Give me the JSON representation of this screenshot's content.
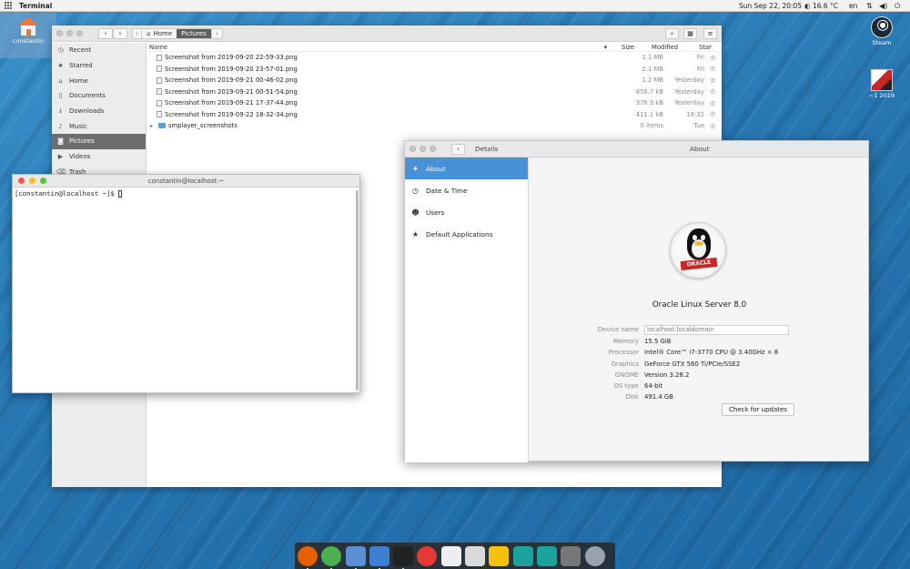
{
  "topbar": {
    "app_name": "Terminal",
    "clock": "Sun Sep 22, 20:05",
    "weather": "16.6 °C",
    "lang": "en"
  },
  "desktop": {
    "home_label": "constantin",
    "steam_label": "Steam",
    "game_label": "~1 2019"
  },
  "files": {
    "crumbs": [
      "Home",
      "Pictures"
    ],
    "sidebar": [
      {
        "label": "Recent",
        "icon": "clock-icon"
      },
      {
        "label": "Starred",
        "icon": "star-icon"
      },
      {
        "label": "Home",
        "icon": "home-icon"
      },
      {
        "label": "Documents",
        "icon": "document-icon"
      },
      {
        "label": "Downloads",
        "icon": "download-icon"
      },
      {
        "label": "Music",
        "icon": "music-icon"
      },
      {
        "label": "Pictures",
        "icon": "camera-icon"
      },
      {
        "label": "Videos",
        "icon": "video-icon"
      },
      {
        "label": "Trash",
        "icon": "trash-icon"
      }
    ],
    "columns": {
      "name": "Name",
      "size": "Size",
      "modified": "Modified",
      "star": "Star"
    },
    "rows": [
      {
        "name": "Screenshot from 2019-09-20 22-59-33.png",
        "size": "1.1 MB",
        "modified": "Fri"
      },
      {
        "name": "Screenshot from 2019-09-20 23-57-01.png",
        "size": "2.1 MB",
        "modified": "Fri"
      },
      {
        "name": "Screenshot from 2019-09-21 00-46-02.png",
        "size": "1.2 MB",
        "modified": "Yesterday"
      },
      {
        "name": "Screenshot from 2019-09-21 00-51-54.png",
        "size": "856.7 kB",
        "modified": "Yesterday"
      },
      {
        "name": "Screenshot from 2019-09-21 17-37-44.png",
        "size": "376.9 kB",
        "modified": "Yesterday"
      },
      {
        "name": "Screenshot from 2019-09-22 18-32-34.png",
        "size": "411.1 kB",
        "modified": "18:32"
      },
      {
        "name": "smplayer_screenshots",
        "size": "0 items",
        "modified": "Tue"
      }
    ]
  },
  "terminal": {
    "title": "constantin@localhost:~",
    "prompt": "[constantin@localhost ~]$ "
  },
  "details": {
    "title": "Details",
    "panel_title": "About",
    "sidebar": [
      {
        "label": "About",
        "icon": "plus-star-icon"
      },
      {
        "label": "Date & Time",
        "icon": "clock-icon"
      },
      {
        "label": "Users",
        "icon": "users-icon"
      },
      {
        "label": "Default Applications",
        "icon": "star-icon"
      }
    ],
    "logo_text": "ORACLE",
    "os_name": "Oracle Linux Server 8.0",
    "device_name_label": "Device name",
    "device_name_value": "localhost.localdomain",
    "specs": [
      {
        "key": "Memory",
        "value": "15.5 GiB"
      },
      {
        "key": "Processor",
        "value": "Intel® Core™ i7-3770 CPU @ 3.40GHz × 8"
      },
      {
        "key": "Graphics",
        "value": "GeForce GTX 560 Ti/PCIe/SSE2"
      },
      {
        "key": "GNOME",
        "value": "Version 3.28.2"
      },
      {
        "key": "OS type",
        "value": "64-bit"
      },
      {
        "key": "Disk",
        "value": "491.4 GB"
      }
    ],
    "update_button": "Check for updates"
  },
  "dock": [
    {
      "name": "firefox-icon",
      "color": "#e66000"
    },
    {
      "name": "chrome-icon",
      "color": "#4caf50"
    },
    {
      "name": "text-editor-icon",
      "color": "#5b8fd6"
    },
    {
      "name": "file-manager-icon",
      "color": "#3d7fd0"
    },
    {
      "name": "terminal-icon",
      "color": "#222222"
    },
    {
      "name": "lifebuoy-icon",
      "color": "#e53935"
    },
    {
      "name": "documents-icon",
      "color": "#eeeeee"
    },
    {
      "name": "archive-icon",
      "color": "#d9d9d9"
    },
    {
      "name": "radiation-icon",
      "color": "#f4c20d"
    },
    {
      "name": "mendeley-icon",
      "color": "#1aa39a"
    },
    {
      "name": "maps-icon",
      "color": "#1aa39a"
    },
    {
      "name": "settings-icon",
      "color": "#777777"
    },
    {
      "name": "launcher-icon",
      "color": "#9aa3ad"
    }
  ]
}
